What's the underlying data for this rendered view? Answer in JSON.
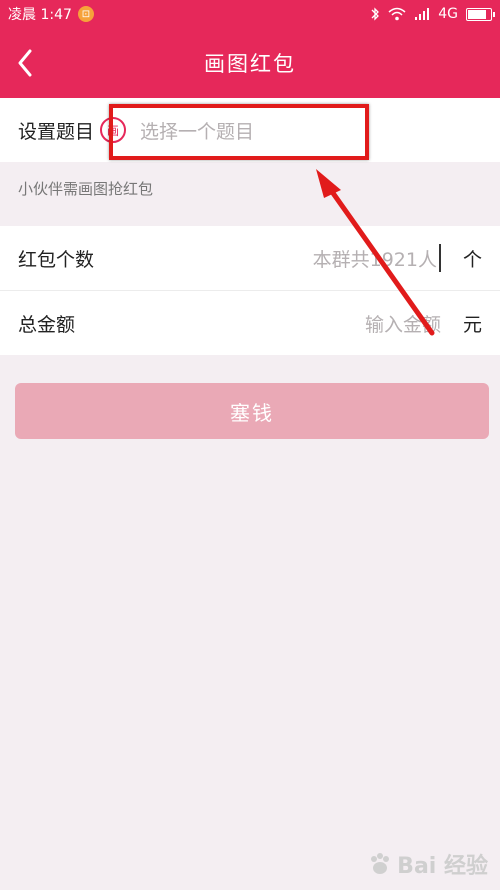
{
  "statusbar": {
    "time": "凌晨 1:47",
    "notif_icon_text": "⊡",
    "network": "4G"
  },
  "navbar": {
    "title": "画图红包"
  },
  "topic": {
    "label": "设置题目",
    "icon_text": "画",
    "placeholder": "选择一个题目"
  },
  "hint": "小伙伴需画图抢红包",
  "count": {
    "label": "红包个数",
    "placeholder": "本群共1921人",
    "unit": "个"
  },
  "amount": {
    "label": "总金额",
    "placeholder": "输入金额",
    "unit": "元"
  },
  "submit_label": "塞钱",
  "watermark": "Bai 经验",
  "colors": {
    "brand": "#e6285a",
    "button_disabled": "#eaa9b6",
    "annotation": "#e11b1b"
  }
}
